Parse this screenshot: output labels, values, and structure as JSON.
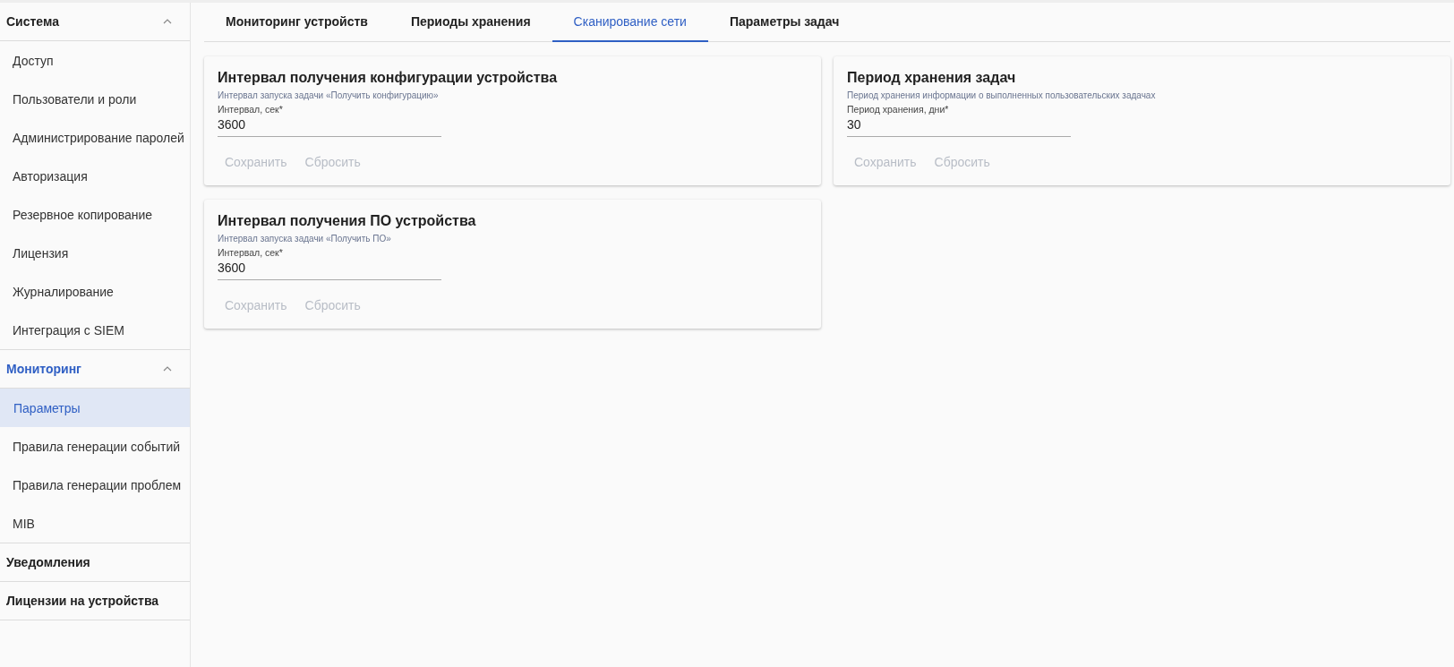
{
  "sidebar": {
    "groups": [
      {
        "label": "Система",
        "expanded": true,
        "active": false,
        "items": [
          {
            "label": "Доступ",
            "selected": false
          },
          {
            "label": "Пользователи и роли",
            "selected": false
          },
          {
            "label": "Администрирование паролей",
            "selected": false
          },
          {
            "label": "Авторизация",
            "selected": false
          },
          {
            "label": "Резервное копирование",
            "selected": false
          },
          {
            "label": "Лицензия",
            "selected": false
          },
          {
            "label": "Журналирование",
            "selected": false
          },
          {
            "label": "Интеграция с SIEM",
            "selected": false
          }
        ]
      },
      {
        "label": "Мониторинг",
        "expanded": true,
        "active": true,
        "items": [
          {
            "label": "Параметры",
            "selected": true
          },
          {
            "label": "Правила генерации событий",
            "selected": false
          },
          {
            "label": "Правила генерации проблем",
            "selected": false
          },
          {
            "label": "MIB",
            "selected": false
          }
        ]
      },
      {
        "label": "Уведомления",
        "expanded": false,
        "active": false
      },
      {
        "label": "Лицензии на устройства",
        "expanded": false,
        "active": false
      }
    ]
  },
  "tabs": [
    {
      "label": "Мониторинг устройств",
      "selected": false
    },
    {
      "label": "Периоды хранения",
      "selected": false
    },
    {
      "label": "Сканирование сети",
      "selected": true
    },
    {
      "label": "Параметры задач",
      "selected": false
    }
  ],
  "cards": [
    {
      "title": "Интервал получения конфигурации устройства",
      "description": "Интервал запуска задачи «Получить конфигурацию»",
      "field": {
        "label": "Интервал, сек",
        "required_mark": "*",
        "value": "3600"
      },
      "buttons": [
        {
          "label": "Сохранить",
          "disabled": true
        },
        {
          "label": "Сбросить",
          "disabled": true
        }
      ]
    },
    {
      "title": "Период хранения задач",
      "description": "Период хранения информации о выполненных пользовательских задачах",
      "field": {
        "label": "Период хранения, дни",
        "required_mark": "*",
        "value": "30"
      },
      "buttons": [
        {
          "label": "Сохранить",
          "disabled": true
        },
        {
          "label": "Сбросить",
          "disabled": true
        }
      ]
    },
    {
      "title": "Интервал получения ПО устройства",
      "description": "Интервал запуска задачи «Получить ПО»",
      "field": {
        "label": "Интервал, сек",
        "required_mark": "*",
        "value": "3600"
      },
      "buttons": [
        {
          "label": "Сохранить",
          "disabled": true
        },
        {
          "label": "Сбросить",
          "disabled": true
        }
      ]
    }
  ]
}
